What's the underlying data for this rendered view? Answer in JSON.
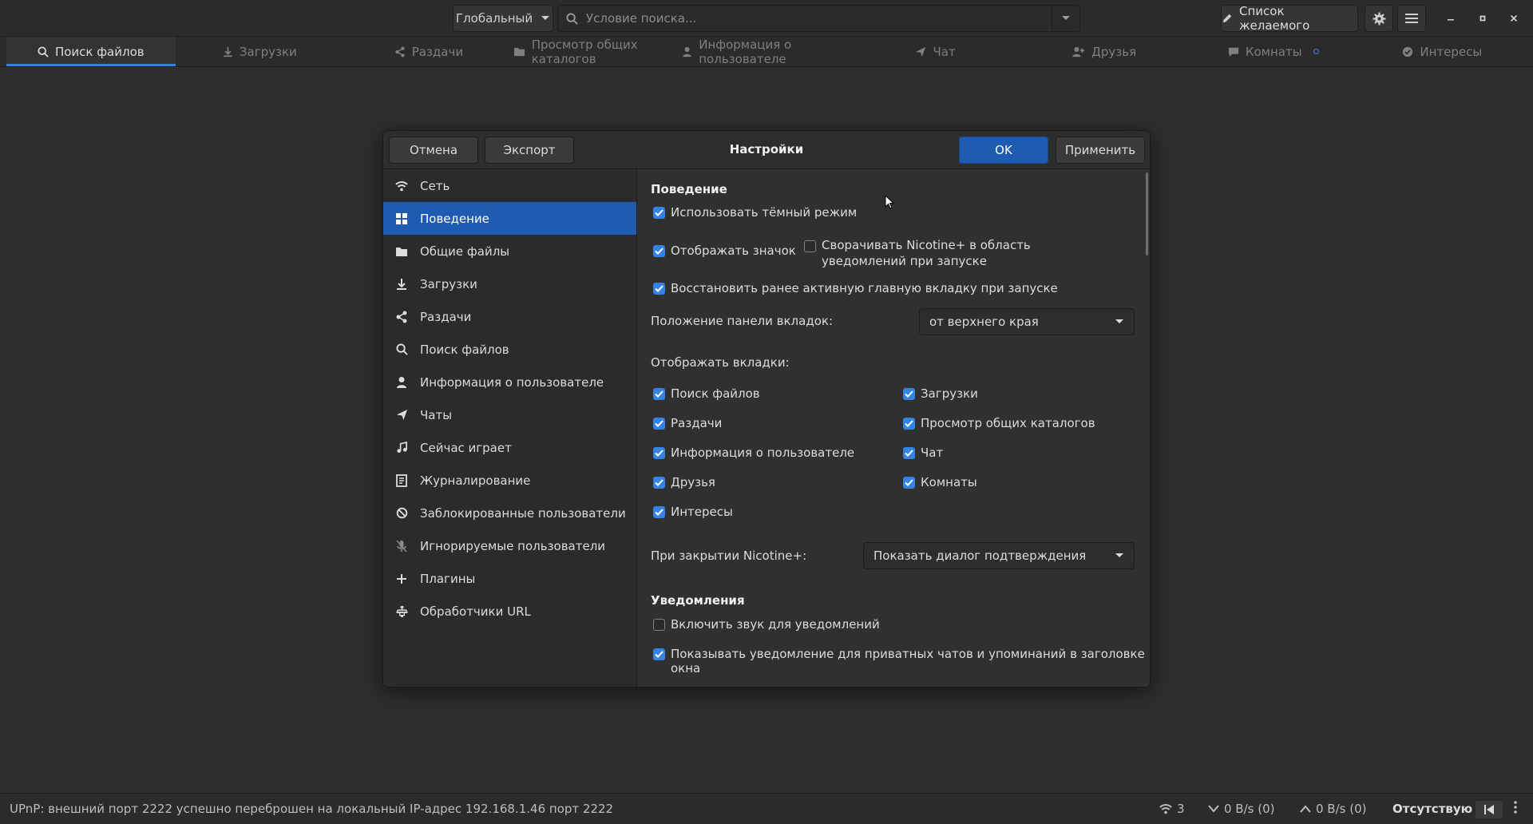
{
  "header": {
    "scope_label": "Глобальный",
    "search_placeholder": "Условие поиска...",
    "wishlist_label": "Список желаемого"
  },
  "tabs": [
    {
      "label": "Поиск файлов",
      "icon": "search-icon"
    },
    {
      "label": "Загрузки",
      "icon": "download-icon"
    },
    {
      "label": "Раздачи",
      "icon": "share-icon"
    },
    {
      "label": "Просмотр общих каталогов",
      "icon": "folder-icon"
    },
    {
      "label": "Информация о пользователе",
      "icon": "user-icon"
    },
    {
      "label": "Чат",
      "icon": "send-icon"
    },
    {
      "label": "Друзья",
      "icon": "add-user-icon"
    },
    {
      "label": "Комнаты",
      "icon": "chat-icon"
    },
    {
      "label": "Интересы",
      "icon": "check-circle-icon"
    }
  ],
  "dialog": {
    "title": "Настройки",
    "cancel_label": "Отмена",
    "export_label": "Экспорт",
    "ok_label": "OK",
    "apply_label": "Применить",
    "sidebar": [
      "Сеть",
      "Поведение",
      "Общие файлы",
      "Загрузки",
      "Раздачи",
      "Поиск файлов",
      "Информация о пользователе",
      "Чаты",
      "Сейчас играет",
      "Журналирование",
      "Заблокированные пользователи",
      "Игнорируемые пользователи",
      "Плагины",
      "Обработчики URL"
    ],
    "behavior": {
      "section_title": "Поведение",
      "dark_mode": "Использовать тёмный режим",
      "show_icon": "Отображать значок",
      "minimize_tray": "Сворачивать Nicotine+ в область уведомлений при запуске",
      "restore_tab": "Восстановить ранее активную главную вкладку при запуске",
      "tab_position_label": "Положение панели вкладок:",
      "tab_position_value": "от верхнего края",
      "visible_tabs_label": "Отображать вкладки:",
      "visible_tabs_left": [
        "Поиск файлов",
        "Раздачи",
        "Информация о пользователе",
        "Друзья",
        "Интересы"
      ],
      "visible_tabs_right": [
        "Загрузки",
        "Просмотр общих каталогов",
        "Чат",
        "Комнаты"
      ],
      "on_close_label": "При закрытии Nicotine+:",
      "on_close_value": "Показать диалог подтверждения"
    },
    "notifications": {
      "section_title": "Уведомления",
      "sound": "Включить звук для уведомлений",
      "title_notify": "Показывать уведомление для приватных чатов и упоминаний в заголовке окна"
    }
  },
  "status": {
    "message": "UPnP: внешний порт 2222 успешно переброшен на локальный IP-адрес 192.168.1.46 порт 2222",
    "connections": "3",
    "download_speed": "0 B/s (0)",
    "upload_speed": "0 B/s (0)",
    "away_label": "Отсутствую"
  },
  "colors": {
    "accent": "#3584e4",
    "primary_button": "#1f5bb0",
    "background": "#2e2e2e"
  }
}
